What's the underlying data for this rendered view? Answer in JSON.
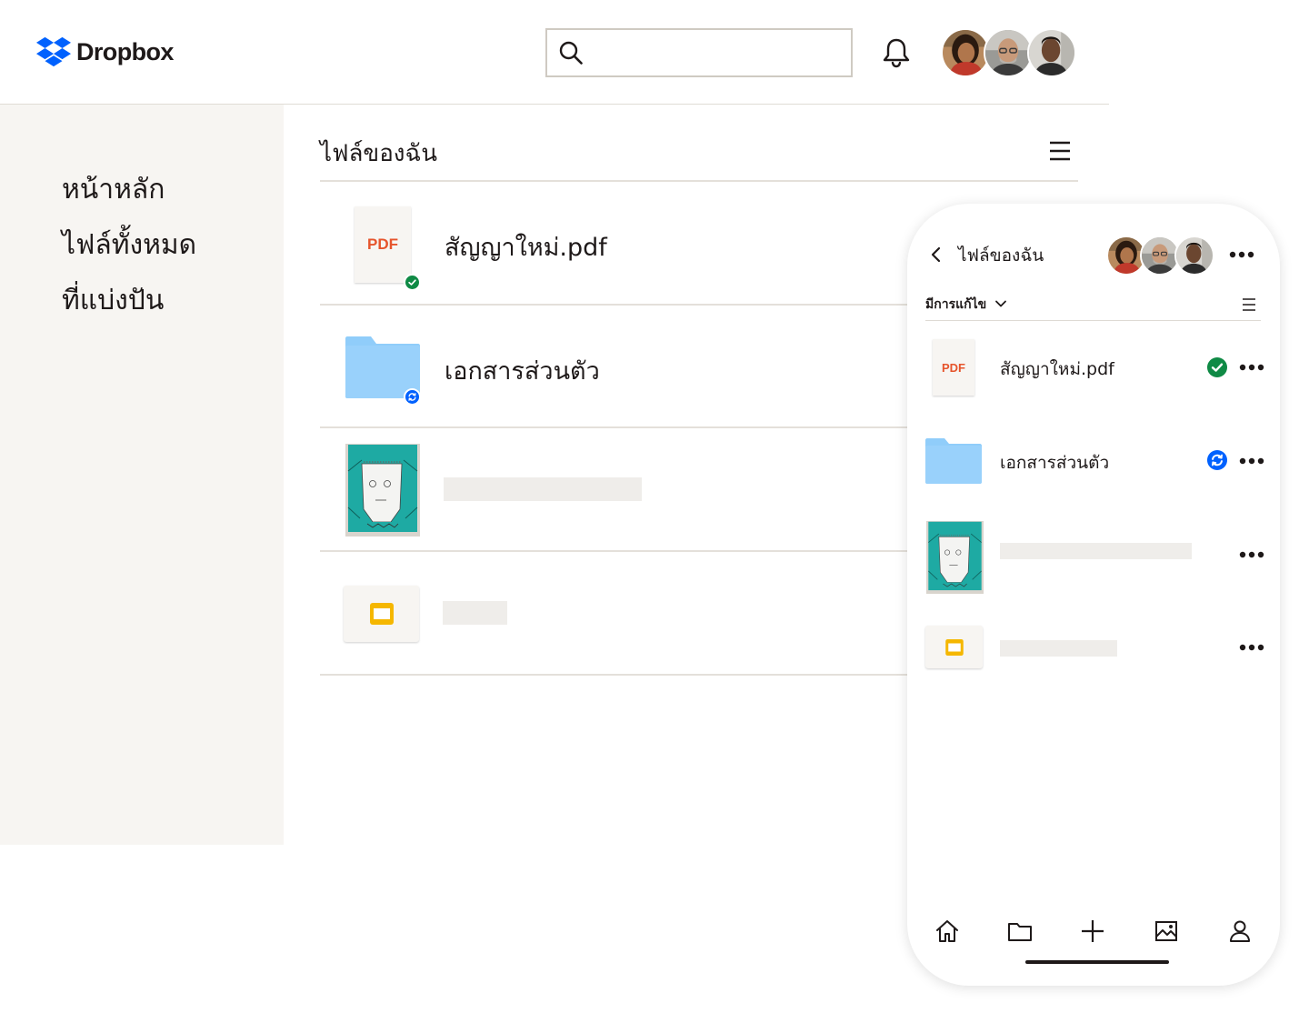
{
  "brand": {
    "name": "Dropbox",
    "color": "#0061fe"
  },
  "header": {
    "search": {
      "placeholder": "",
      "icon": "search-icon"
    },
    "notifications_icon": "bell-icon",
    "avatars": [
      "avatar-woman",
      "avatar-man-glasses",
      "avatar-man"
    ]
  },
  "sidebar": {
    "items": [
      {
        "label": "หน้าหลัก"
      },
      {
        "label": "ไฟล์ทั้งหมด"
      },
      {
        "label": "ที่แบ่งปัน"
      }
    ]
  },
  "main": {
    "title": "ไฟล์ของฉัน",
    "view_icon": "list-view-icon",
    "files": [
      {
        "name": "สัญญาใหม่.pdf",
        "type": "pdf",
        "type_label": "PDF",
        "status": "synced"
      },
      {
        "name": "เอกสารส่วนตัว",
        "type": "folder",
        "status": "syncing"
      },
      {
        "name": "",
        "type": "image",
        "status": ""
      },
      {
        "name": "",
        "type": "slides",
        "status": ""
      }
    ]
  },
  "phone": {
    "title": "ไฟล์ของฉัน",
    "sort_label": "มีการแก้ไข",
    "files": [
      {
        "name": "สัญญาใหม่.pdf",
        "type": "pdf",
        "type_label": "PDF",
        "status": "synced"
      },
      {
        "name": "เอกสารส่วนตัว",
        "type": "folder",
        "status": "syncing"
      },
      {
        "name": "",
        "type": "image",
        "status": ""
      },
      {
        "name": "",
        "type": "slides",
        "status": ""
      }
    ],
    "tabs": [
      "home-icon",
      "folder-icon",
      "plus-icon",
      "photos-icon",
      "account-icon"
    ]
  },
  "colors": {
    "synced": "#0f8a45",
    "syncing": "#0061fe",
    "pdf": "#e6542c",
    "folder": "#90cdfa",
    "slides": "#f5b700",
    "sidebar_bg": "#f7f5f2"
  }
}
